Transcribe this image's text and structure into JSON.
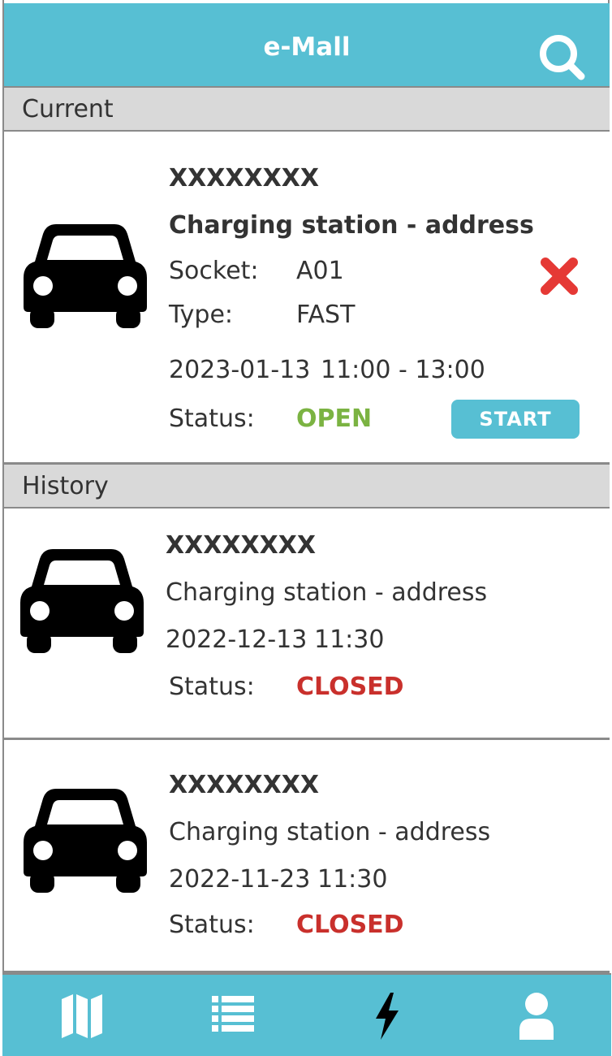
{
  "header": {
    "title": "e-Mall",
    "search_icon": "search-icon"
  },
  "sections": {
    "current_label": "Current",
    "history_label": "History"
  },
  "current": {
    "name": "XXXXXXXX",
    "station": "Charging station - address",
    "socket_label": "Socket:",
    "socket_value": "A01",
    "type_label": "Type:",
    "type_value": "FAST",
    "date": "2023-01-13",
    "time": "11:00 - 13:00",
    "status_label": "Status:",
    "status_value": "OPEN",
    "start_label": "START",
    "cancel_icon": "close-icon",
    "status_color": "#7bb342"
  },
  "history": [
    {
      "name": "XXXXXXXX",
      "station": "Charging station - address",
      "date": "2022-12-13",
      "time": "11:30",
      "status_label": "Status:",
      "status_value": "CLOSED"
    },
    {
      "name": "XXXXXXXX",
      "station": "Charging station - address",
      "date": "2022-11-23",
      "time": "11:30",
      "status_label": "Status:",
      "status_value": "CLOSED"
    }
  ],
  "nav": {
    "items": [
      "map-icon",
      "list-icon",
      "lightning-icon",
      "user-icon"
    ],
    "active": "lightning-icon"
  },
  "colors": {
    "accent": "#57bfd3",
    "open": "#7bb342",
    "closed": "#c9302c",
    "section_bg": "#d9d9d9"
  }
}
